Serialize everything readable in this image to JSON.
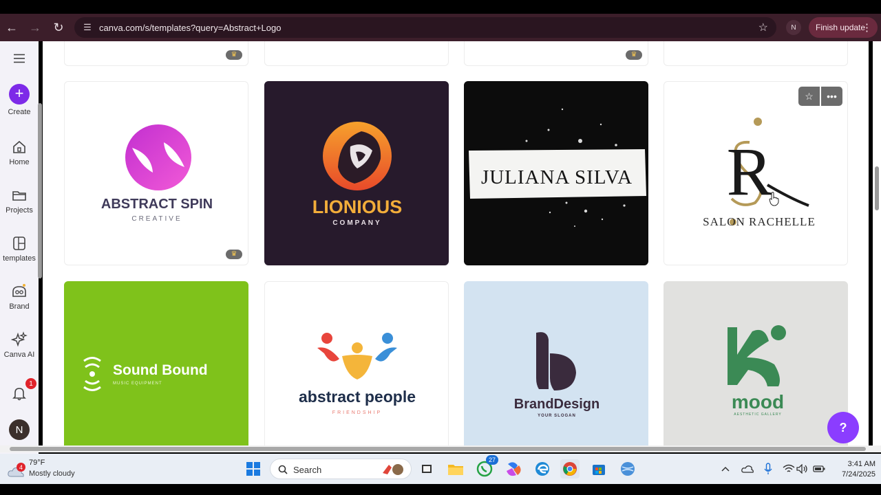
{
  "browser": {
    "url": "canva.com/s/templates?query=Abstract+Logo",
    "profile_initial": "N",
    "finish_update_label": "Finish update"
  },
  "sidebar": {
    "create_label": "Create",
    "items": [
      {
        "label": "Home",
        "icon": "home-icon"
      },
      {
        "label": "Projects",
        "icon": "folder-icon"
      },
      {
        "label": "templates",
        "icon": "templates-icon"
      },
      {
        "label": "Brand",
        "icon": "brand-icon"
      },
      {
        "label": "Canva AI",
        "icon": "sparkle-icon"
      }
    ],
    "notification_count": "1",
    "avatar_initial": "N"
  },
  "templates": {
    "row2": [
      {
        "title": "ABSTRACT SPIN",
        "subtitle": "CREATIVE",
        "premium": true
      },
      {
        "title": "LIONIOUS",
        "subtitle": "COMPANY",
        "premium": false
      },
      {
        "title": "JULIANA SILVA",
        "premium": false
      },
      {
        "title": "SALON RACHELLE",
        "premium": false
      }
    ],
    "row3": [
      {
        "title": "Sound Bound",
        "subtitle": "MUSIC EQUIPMENT"
      },
      {
        "title": "abstract people",
        "subtitle": "FRIENDSHIP"
      },
      {
        "title": "BrandDesign",
        "subtitle": "YOUR SLOGAN"
      },
      {
        "title": "mood",
        "subtitle": "AESTHETIC GALLERY"
      }
    ]
  },
  "help_label": "?",
  "taskbar": {
    "weather_badge": "4",
    "temperature": "79°F",
    "condition": "Mostly cloudy",
    "search_label": "Search",
    "whatsapp_badge": "27",
    "time": "3:41 AM",
    "date": "7/24/2025"
  },
  "colors": {
    "canva_purple": "#7d2ae8",
    "chrome_bar": "#3c1e2a",
    "lime_card": "#7fc21b",
    "sky_card": "#d3e3f1",
    "grey_card": "#e1e1df",
    "lion_card": "#271a2c"
  }
}
